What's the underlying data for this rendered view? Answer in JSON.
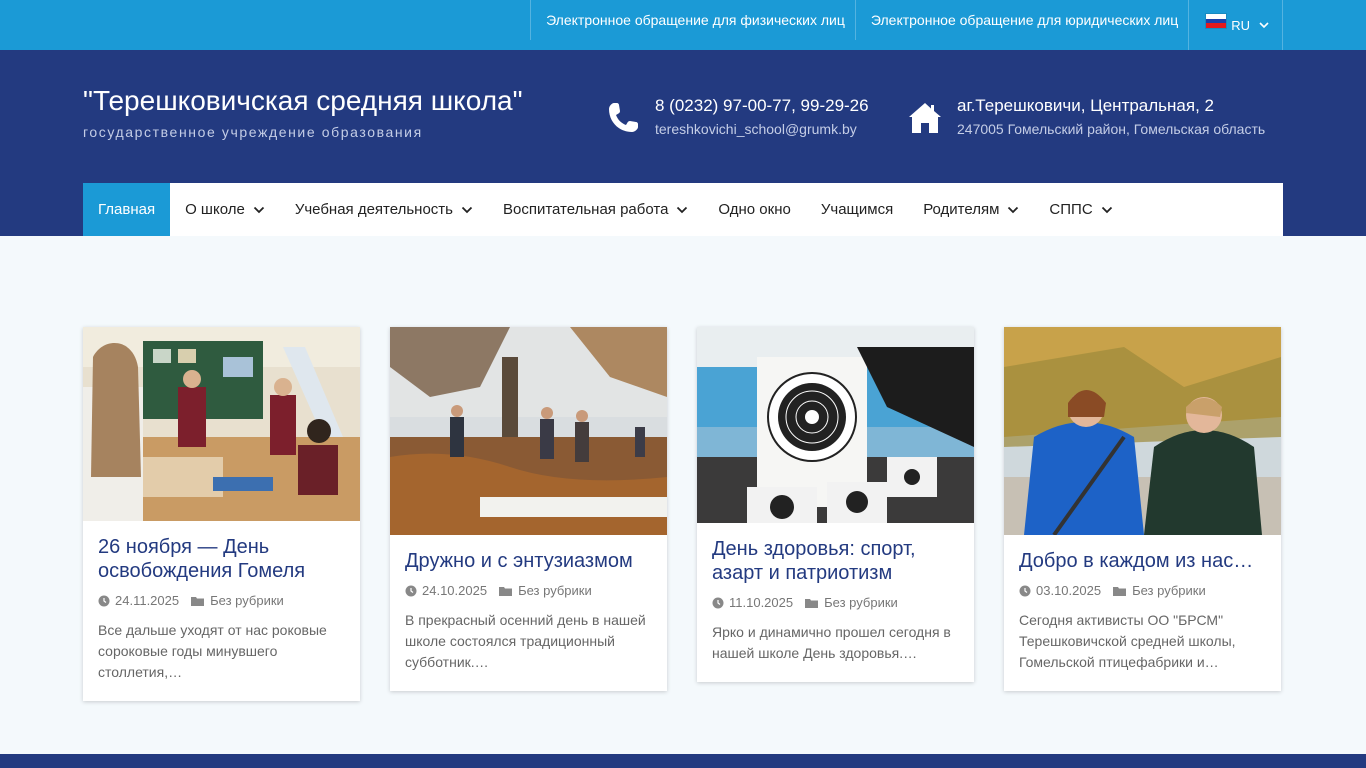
{
  "topbar": {
    "links": [
      "Электронное обращение для физических лиц",
      "Электронное обращение для юридических лиц"
    ],
    "lang_label": "RU",
    "lang_flag_colors": [
      "#ffffff",
      "#1c3faa",
      "#e4181c"
    ]
  },
  "header": {
    "title": "\"Терешковичская средняя школа\"",
    "subtitle": "государственное учреждение образования",
    "phone": "8 (0232) 97-00-77, 99-29-26",
    "email": "tereshkovichi_school@grumk.by",
    "address": "аг.Терешковичи, Центральная, 2",
    "address_sub": "247005 Гомельский район, Гомельская область",
    "phone_icon": "phone-icon",
    "home_icon": "home-icon"
  },
  "nav": [
    {
      "label": "Главная",
      "active": true,
      "has_sub": false
    },
    {
      "label": "О школе",
      "active": false,
      "has_sub": true
    },
    {
      "label": "Учебная деятельность",
      "active": false,
      "has_sub": true
    },
    {
      "label": "Воспитательная работа",
      "active": false,
      "has_sub": true
    },
    {
      "label": "Одно окно",
      "active": false,
      "has_sub": false
    },
    {
      "label": "Учащимся",
      "active": false,
      "has_sub": false
    },
    {
      "label": "Родителям",
      "active": false,
      "has_sub": true
    },
    {
      "label": "СППС",
      "active": false,
      "has_sub": true
    }
  ],
  "posts": [
    {
      "title": "26 ноября — День освобождения Гомеля",
      "date": "24.11.2025",
      "category": "Без рубрики",
      "excerpt": "Все дальше уходят от нас роковые сороковые годы минувшего столлетия,…",
      "image": "classroom-photo"
    },
    {
      "title": "Дружно и с энтузиазмом",
      "date": "24.10.2025",
      "category": "Без рубрики",
      "excerpt": "В прекрасный осенний день в нашей школе состоялся традиционный субботник.…",
      "image": "autumn-cleanup-photo"
    },
    {
      "title": "День здоровья: спорт, азарт и патриотизм",
      "date": "11.10.2025",
      "category": "Без рубрики",
      "excerpt": "Ярко и динамично прошел сегодня в нашей школе День здоровья.…",
      "image": "shooting-target-photo"
    },
    {
      "title": "Добро в каждом из нас…",
      "date": "03.10.2025",
      "category": "Без рубрики",
      "excerpt": "Сегодня активисты ОО \"БРСМ\" Терешковичской средней школы, Гомельской птицефабрики и…",
      "image": "volunteers-photo"
    }
  ],
  "colors": {
    "topbar": "#1b9ad6",
    "header": "#233a80",
    "accent": "#1b9ad6",
    "title_link": "#233a80"
  }
}
